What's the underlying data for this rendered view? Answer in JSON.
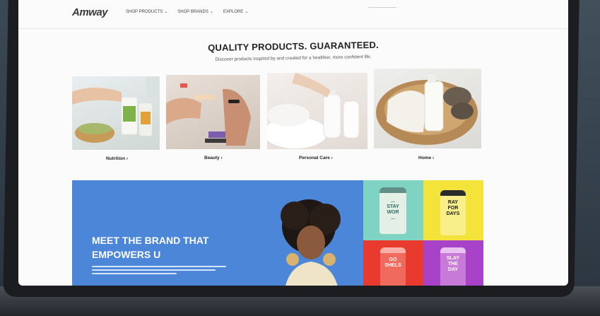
{
  "header": {
    "logo": "Amway",
    "nav": [
      {
        "label": "SHOP PRODUCTS",
        "chevron": "⌄"
      },
      {
        "label": "SHOP BRANDS",
        "chevron": "⌄"
      },
      {
        "label": "EXPLORE",
        "chevron": "⌄"
      }
    ]
  },
  "hero": {
    "headline": "QUALITY PRODUCTS. GUARANTEED.",
    "subline": "Discover products inspired by and created for a healthier, more confident life."
  },
  "categories": [
    {
      "label": "Nutrition ›",
      "image": "nutrition-photo"
    },
    {
      "label": "Beauty ›",
      "image": "beauty-photo"
    },
    {
      "label": "Personal Care ›",
      "image": "personal-care-photo"
    },
    {
      "label": "Home ›",
      "image": "home-photo"
    }
  ],
  "banner": {
    "title": "MEET THE BRAND THAT EMPOWERS U",
    "products": [
      {
        "text": "...\nSTAY\nWOR\n...",
        "color": "#7fd3c2"
      },
      {
        "text": "RAY\nFOR\nDAYS",
        "color": "#f4e33b"
      },
      {
        "text": "GO\nSHELS",
        "color": "#e83a2e"
      },
      {
        "text": "SLAY\nTHE\nDAY",
        "color": "#a842c8"
      }
    ]
  },
  "colors": {
    "banner_blue": "#4b86d9",
    "screen_bg": "#fbfbfb",
    "frame": "#1b1d20"
  }
}
